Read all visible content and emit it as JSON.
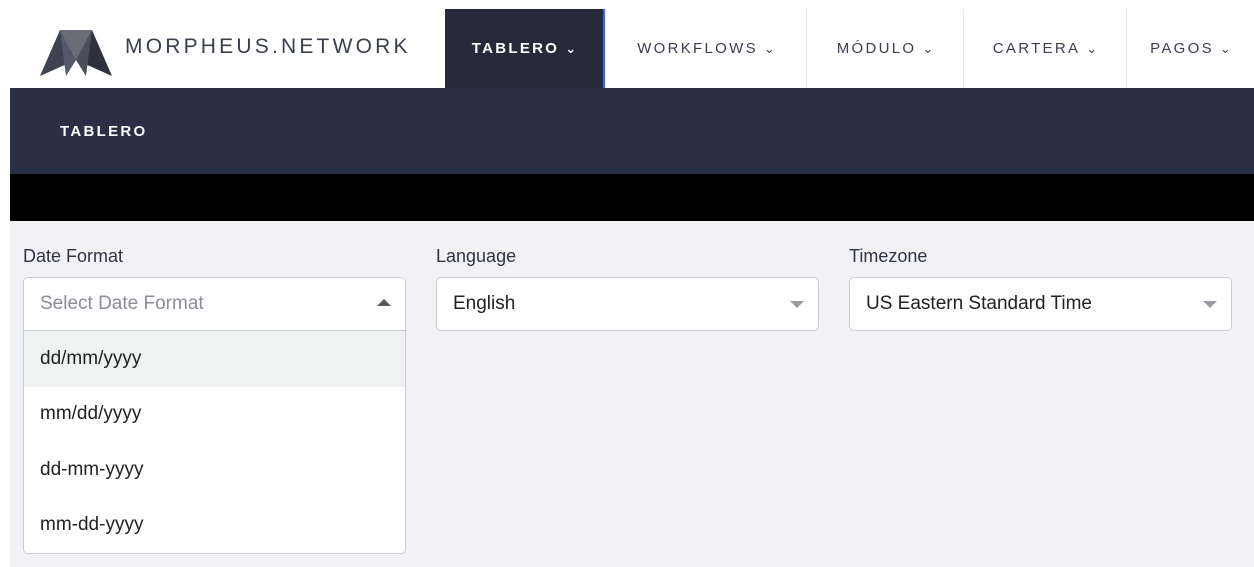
{
  "brand": {
    "name": "MORPHEUS.NETWORK",
    "logo_icon": "morpheus-logo-icon"
  },
  "nav": {
    "items": [
      {
        "label": "TABLERO",
        "active": true
      },
      {
        "label": "WORKFLOWS",
        "active": false
      },
      {
        "label": "MÓDULO",
        "active": false
      },
      {
        "label": "CARTERA",
        "active": false
      },
      {
        "label": "PAGOS",
        "active": false
      }
    ],
    "chevron": "⌄"
  },
  "subheader": {
    "title": "TABLERO"
  },
  "settings": {
    "date_format": {
      "label": "Date Format",
      "placeholder": "Select Date Format",
      "options": [
        "dd/mm/yyyy",
        "mm/dd/yyyy",
        "dd-mm-yyyy",
        "mm-dd-yyyy"
      ],
      "highlighted_index": 0
    },
    "language": {
      "label": "Language",
      "value": "English"
    },
    "timezone": {
      "label": "Timezone",
      "value": "US Eastern Standard Time"
    }
  },
  "colors": {
    "nav_active_bg": "#262a3b",
    "subheader_bg": "#2b2f45",
    "content_bg": "#f2f2f6",
    "option_highlight_bg": "#eef3f2"
  }
}
